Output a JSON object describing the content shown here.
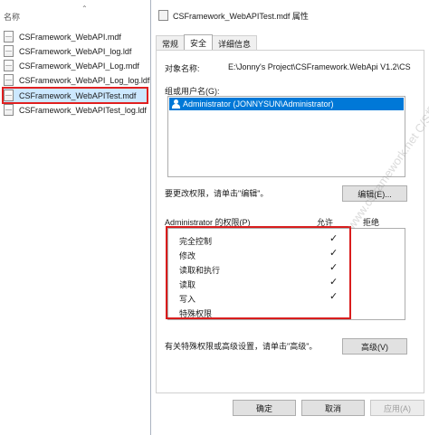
{
  "explorer": {
    "column_header": "名称",
    "files": [
      {
        "name": "CSFramework_WebAPI.mdf",
        "selected": false
      },
      {
        "name": "CSFramework_WebAPI_log.ldf",
        "selected": false
      },
      {
        "name": "CSFramework_WebAPI_Log.mdf",
        "selected": false
      },
      {
        "name": "CSFramework_WebAPI_Log_log.ldf",
        "selected": false
      },
      {
        "name": "CSFramework_WebAPITest.mdf",
        "selected": true
      },
      {
        "name": "CSFramework_WebAPITest_log.ldf",
        "selected": false
      }
    ]
  },
  "dialog": {
    "title": "CSFramework_WebAPITest.mdf 属性",
    "tabs": [
      "常规",
      "安全",
      "详细信息"
    ],
    "active_tab": "安全",
    "object_name_label": "对象名称:",
    "object_name_value": "E:\\Jonny's Project\\CSFramework.WebApi V1.2\\CS",
    "group_label": "组或用户名(G):",
    "users": [
      "Administrator (JONNYSUN\\Administrator)"
    ],
    "change_hint": "要更改权限，请单击\"编辑\"。",
    "edit_button": "编辑(E)...",
    "perm_label": "Administrator 的权限(P)",
    "allow_header": "允许",
    "deny_header": "拒绝",
    "permissions": [
      {
        "name": "完全控制",
        "allow": "✓"
      },
      {
        "name": "修改",
        "allow": "✓"
      },
      {
        "name": "读取和执行",
        "allow": "✓"
      },
      {
        "name": "读取",
        "allow": "✓"
      },
      {
        "name": "写入",
        "allow": "✓"
      },
      {
        "name": "特殊权限",
        "allow": ""
      }
    ],
    "advanced_hint": "有关特殊权限或高级设置，请单击\"高级\"。",
    "advanced_button": "高级(V)",
    "ok_button": "确定",
    "cancel_button": "取消",
    "apply_button": "应用(A)",
    "watermark": "www.csframework.net  C/S框架网"
  },
  "colors": {
    "selection": "#0078d7",
    "highlight_border": "#d91d1d",
    "explorer_selection": "#cce8ff"
  }
}
